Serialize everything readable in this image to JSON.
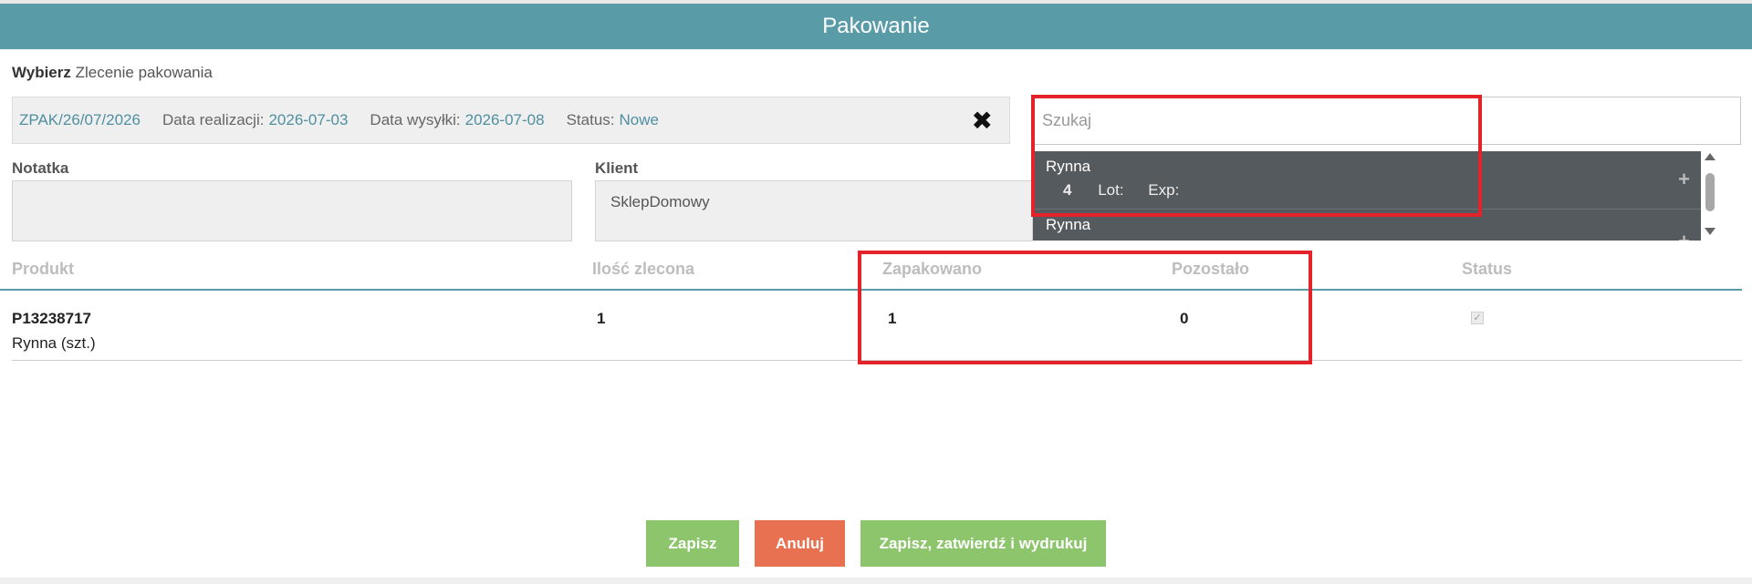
{
  "header": {
    "title": "Pakowanie"
  },
  "order_select": {
    "label_bold": "Wybierz",
    "label_rest": "Zlecenie pakowania"
  },
  "order": {
    "id": "ZPAK/26/07/2026",
    "realization_label": "Data realizacji:",
    "realization_date": "2026-07-03",
    "shipping_label": "Data wysyłki:",
    "shipping_date": "2026-07-08",
    "status_label": "Status:",
    "status_value": "Nowe"
  },
  "search": {
    "placeholder": "Szukaj",
    "results": [
      {
        "name": "Rynna",
        "qty": "4",
        "lot_label": "Lot:",
        "exp_label": "Exp:"
      },
      {
        "name": "Rynna"
      }
    ]
  },
  "note": {
    "label": "Notatka",
    "value": ""
  },
  "client": {
    "label": "Klient",
    "value": "SklepDomowy"
  },
  "table": {
    "headers": [
      "Produkt",
      "Ilość zlecona",
      "Zapakowano",
      "Pozostało",
      "Status"
    ],
    "rows": [
      {
        "code": "P13238717",
        "name": "Rynna (szt.)",
        "ordered": "1",
        "packed": "1",
        "remaining": "0",
        "status_checked": true
      }
    ]
  },
  "buttons": {
    "save": "Zapisz",
    "cancel": "Anuluj",
    "save_confirm_print": "Zapisz, zatwierdź i wydrukuj"
  },
  "colors": {
    "header": "#5a9ba8",
    "save": "#8dc56c",
    "cancel": "#e87152",
    "highlight": "#e3222a",
    "dropdown": "#555a5e"
  }
}
